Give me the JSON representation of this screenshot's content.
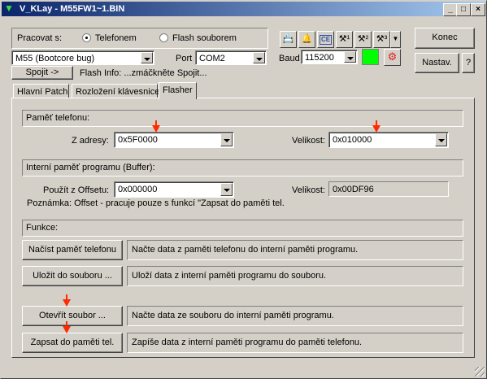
{
  "window": {
    "title": "V_KLay - M55FW1~1.BIN"
  },
  "top": {
    "mode_label": "Pracovat s:",
    "radio_phone": "Telefonem",
    "radio_flash": "Flash souborem",
    "model_value": "M55 (Bootcore bug)",
    "port_label": "Port",
    "port_value": "COM2",
    "baud_label": "Baud",
    "baud_value": "115200",
    "connect_button": "Spojit ->",
    "flash_info": "Flash Info: ...zmáčkněte Spojit...",
    "close_button": "Konec",
    "settings_button": "Nastav.",
    "help_button": "?",
    "status_color": "#00ff00"
  },
  "tabs": [
    "Hlavní Patch",
    "Rozložení klávesnice",
    "Flasher"
  ],
  "flasher": {
    "phone_mem_header": "Paměť telefonu:",
    "from_addr_label": "Z adresy:",
    "from_addr_value": "0x5F0000",
    "size_label": "Velikost:",
    "size_value": "0x010000",
    "buffer_header": "Interní paměť programu (Buffer):",
    "offset_label": "Použít z Offsetu:",
    "offset_value": "0x000000",
    "buffer_size_label": "Velikost:",
    "buffer_size_value": "0x00DF96",
    "note": "Poznámka: Offset - pracuje pouze s funkcí \"Zapsat do paměti tel.",
    "functions_header": "Funkce:",
    "functions": [
      {
        "button": "Načíst paměť telefonu",
        "desc": "Načte data z paměti telefonu do interní paměti programu."
      },
      {
        "button": "Uložit do souboru ...",
        "desc": "Uloží data z interní paměti programu do souboru."
      },
      {
        "button": "Otevřít soubor ...",
        "desc": "Načte data ze souboru do interní paměti programu."
      },
      {
        "button": "Zapsat do paměti tel.",
        "desc": "Zapíše data z interní paměti programu do paměti telefonu."
      }
    ]
  },
  "icons": [
    "phone-book-icon",
    "bell-icon",
    "ce-icon",
    "tools-1-icon",
    "tools-2-icon",
    "tools-3-icon"
  ]
}
